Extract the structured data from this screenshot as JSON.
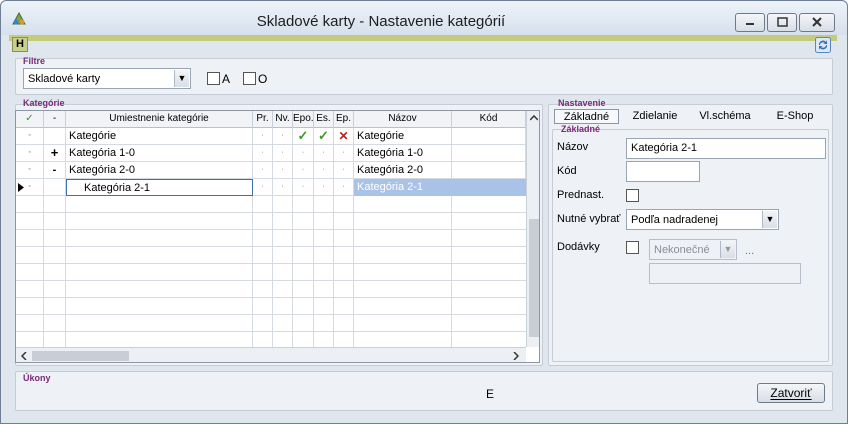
{
  "window": {
    "title": "Skladové karty - Nastavenie kategórií",
    "h_button": "H"
  },
  "filter": {
    "label": "Filtre",
    "combo_value": "Skladové karty",
    "check_a": "A",
    "check_o": "O"
  },
  "categories": {
    "label": "Kategórie",
    "columns": [
      "✓",
      "-",
      "Umiestnenie kategórie",
      "Pr.",
      "Nv.",
      "Epo.",
      "Es.",
      "Ep.",
      "Názov",
      "Kód"
    ],
    "rows": [
      {
        "sel": "◦",
        "tree": "",
        "placement": "Kategórie",
        "pr": "·",
        "nv": "·",
        "epo": "✓",
        "es": "✓",
        "ep": "✕",
        "name": "Kategórie",
        "code": ""
      },
      {
        "sel": "◦",
        "tree": "+",
        "placement": "Kategória 1-0",
        "pr": "·",
        "nv": "·",
        "epo": "·",
        "es": "·",
        "ep": "·",
        "name": "Kategória 1-0",
        "code": ""
      },
      {
        "sel": "◦",
        "tree": "-",
        "placement": "Kategória 2-0",
        "pr": "·",
        "nv": "·",
        "epo": "·",
        "es": "·",
        "ep": "·",
        "name": "Kategória 2-0",
        "code": ""
      },
      {
        "sel": "◦",
        "tree": "",
        "placement": "Kategória 2-1",
        "pr": "·",
        "nv": "·",
        "epo": "·",
        "es": "·",
        "ep": "·",
        "name": "Kategória 2-1",
        "code": ""
      }
    ]
  },
  "settings": {
    "label": "Nastavenie",
    "tabs": [
      "Základné",
      "Zdielanie",
      "Vl.schéma",
      "E-Shop"
    ],
    "section": "Základné",
    "name_label": "Názov",
    "name_value": "Kategória 2-1",
    "code_label": "Kód",
    "code_value": "",
    "prednast_label": "Prednast.",
    "nutne_label": "Nutné vybrať",
    "nutne_value": "Podľa nadradenej",
    "dodavky_label": "Dodávky",
    "dodavky_value": "Nekonečné",
    "ellipsis": "..."
  },
  "actions": {
    "label": "Úkony",
    "center_text": "E",
    "close_label": "Zatvoriť"
  },
  "colors": {
    "selected_row": "#a9c2e8",
    "accent_bar": "#c4cc7c",
    "group_label": "#7a2a7a"
  }
}
